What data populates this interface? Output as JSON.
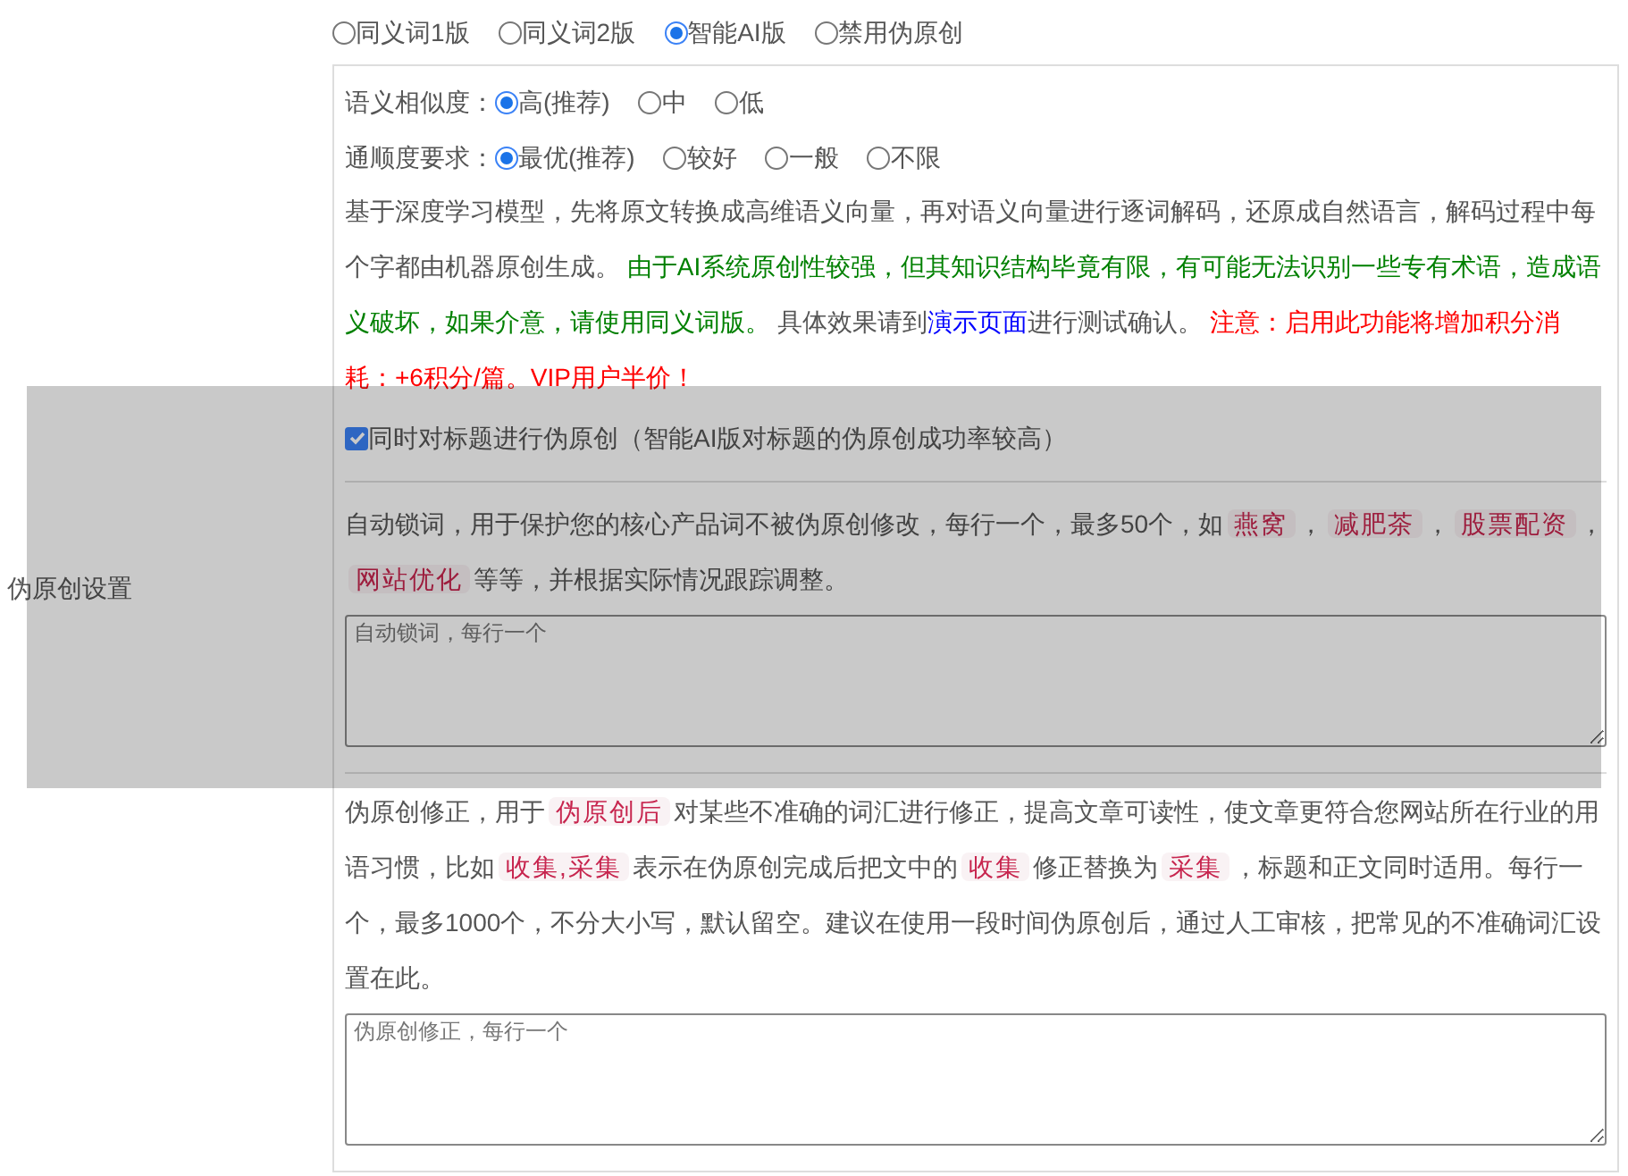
{
  "version_options": [
    {
      "label": "同义词1版",
      "selected": false
    },
    {
      "label": "同义词2版",
      "selected": false
    },
    {
      "label": "智能AI版",
      "selected": true
    },
    {
      "label": "禁用伪原创",
      "selected": false
    }
  ],
  "settings_label": "伪原创设置",
  "similarity": {
    "label": "语义相似度：",
    "options": [
      {
        "label": "高(推荐)",
        "selected": true
      },
      {
        "label": "中",
        "selected": false
      },
      {
        "label": "低",
        "selected": false
      }
    ]
  },
  "fluency": {
    "label": "通顺度要求：",
    "options": [
      {
        "label": "最优(推荐)",
        "selected": true
      },
      {
        "label": "较好",
        "selected": false
      },
      {
        "label": "一般",
        "selected": false
      },
      {
        "label": "不限",
        "selected": false
      }
    ]
  },
  "description": [
    {
      "kind": "plain",
      "text": "基于深度学习模型，先将原文转换成高维语义向量，再对语义向量进行逐词解码，还原成自然语言，解码过程中每个字都由机器原创生成。 "
    },
    {
      "kind": "notice",
      "text": "由于AI系统原创性较强，但其知识结构毕竟有限，有可能无法识别一些专有术语，造成语义破坏，如果介意，请使用同义词版。"
    },
    {
      "kind": "plain",
      "text": " 具体效果请到"
    },
    {
      "kind": "link",
      "text": "演示页面"
    },
    {
      "kind": "plain",
      "text": "进行测试确认。 "
    },
    {
      "kind": "warning",
      "text": "注意：启用此功能将增加积分消耗：+6积分/篇。VIP用户半价！"
    }
  ],
  "title_rewrite": {
    "label": "同时对标题进行伪原创（智能AI版对标题的伪原创成功率较高）",
    "checked": true
  },
  "lock_words": {
    "description": [
      {
        "kind": "plain",
        "text": "自动锁词，用于保护您的核心产品词不被伪原创修改，每行一个，最多50个，如"
      },
      {
        "kind": "chip",
        "text": "燕窝"
      },
      {
        "kind": "plain",
        "text": "，"
      },
      {
        "kind": "chip",
        "text": "减肥茶"
      },
      {
        "kind": "plain",
        "text": "，"
      },
      {
        "kind": "chip",
        "text": "股票配资"
      },
      {
        "kind": "plain",
        "text": "，"
      },
      {
        "kind": "chip",
        "text": "网站优化"
      },
      {
        "kind": "plain",
        "text": "等等，并根据实际情况跟踪调整。"
      }
    ],
    "placeholder": "自动锁词，每行一个"
  },
  "corrections": {
    "description": [
      {
        "kind": "plain",
        "text": "伪原创修正，用于"
      },
      {
        "kind": "chip",
        "text": "伪原创后"
      },
      {
        "kind": "plain",
        "text": "对某些不准确的词汇进行修正，提高文章可读性，使文章更符合您网站所在行业的用语习惯，比如"
      },
      {
        "kind": "chip",
        "text": "收集,采集"
      },
      {
        "kind": "plain",
        "text": "表示在伪原创完成后把文中的"
      },
      {
        "kind": "chip",
        "text": "收集"
      },
      {
        "kind": "plain",
        "text": "修正替换为"
      },
      {
        "kind": "chip",
        "text": "采集"
      },
      {
        "kind": "plain",
        "text": "，标题和正文同时适用。每行一个，最多1000个，不分大小写，默认留空。建议在使用一段时间伪原创后，通过人工审核，把常见的不准确词汇设置在此。"
      }
    ],
    "placeholder": "伪原创修正，每行一个"
  }
}
